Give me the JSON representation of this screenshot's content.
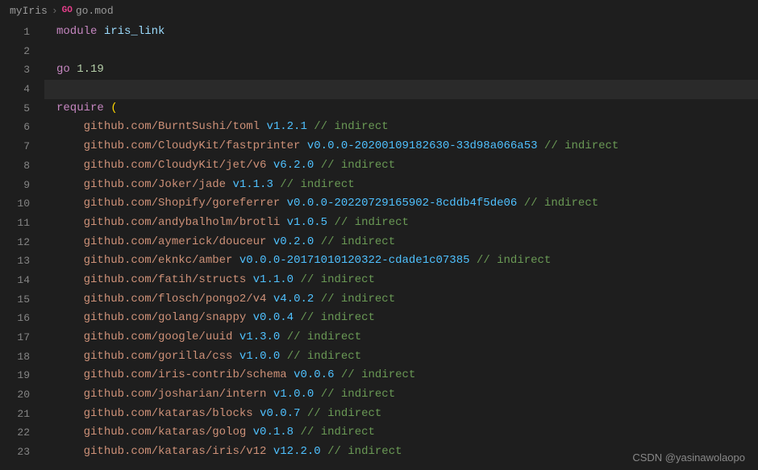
{
  "breadcrumb": {
    "folder": "myIris",
    "file": "go.mod",
    "go_label": "GO"
  },
  "watermark": "CSDN @yasinawolaopo",
  "code": {
    "module_kw": "module",
    "module_name": "iris_link",
    "go_kw": "go",
    "go_version": "1.19",
    "require_kw": "require",
    "open_paren": "(",
    "indirect_comment": "// indirect",
    "deps": [
      {
        "pkg": "github.com/BurntSushi/toml",
        "ver": "v1.2.1"
      },
      {
        "pkg": "github.com/CloudyKit/fastprinter",
        "ver": "v0.0.0-20200109182630-33d98a066a53"
      },
      {
        "pkg": "github.com/CloudyKit/jet/v6",
        "ver": "v6.2.0"
      },
      {
        "pkg": "github.com/Joker/jade",
        "ver": "v1.1.3"
      },
      {
        "pkg": "github.com/Shopify/goreferrer",
        "ver": "v0.0.0-20220729165902-8cddb4f5de06"
      },
      {
        "pkg": "github.com/andybalholm/brotli",
        "ver": "v1.0.5"
      },
      {
        "pkg": "github.com/aymerick/douceur",
        "ver": "v0.2.0"
      },
      {
        "pkg": "github.com/eknkc/amber",
        "ver": "v0.0.0-20171010120322-cdade1c07385"
      },
      {
        "pkg": "github.com/fatih/structs",
        "ver": "v1.1.0"
      },
      {
        "pkg": "github.com/flosch/pongo2/v4",
        "ver": "v4.0.2"
      },
      {
        "pkg": "github.com/golang/snappy",
        "ver": "v0.0.4"
      },
      {
        "pkg": "github.com/google/uuid",
        "ver": "v1.3.0"
      },
      {
        "pkg": "github.com/gorilla/css",
        "ver": "v1.0.0"
      },
      {
        "pkg": "github.com/iris-contrib/schema",
        "ver": "v0.0.6"
      },
      {
        "pkg": "github.com/josharian/intern",
        "ver": "v1.0.0"
      },
      {
        "pkg": "github.com/kataras/blocks",
        "ver": "v0.0.7"
      },
      {
        "pkg": "github.com/kataras/golog",
        "ver": "v0.1.8"
      },
      {
        "pkg": "github.com/kataras/iris/v12",
        "ver": "v12.2.0"
      }
    ]
  }
}
